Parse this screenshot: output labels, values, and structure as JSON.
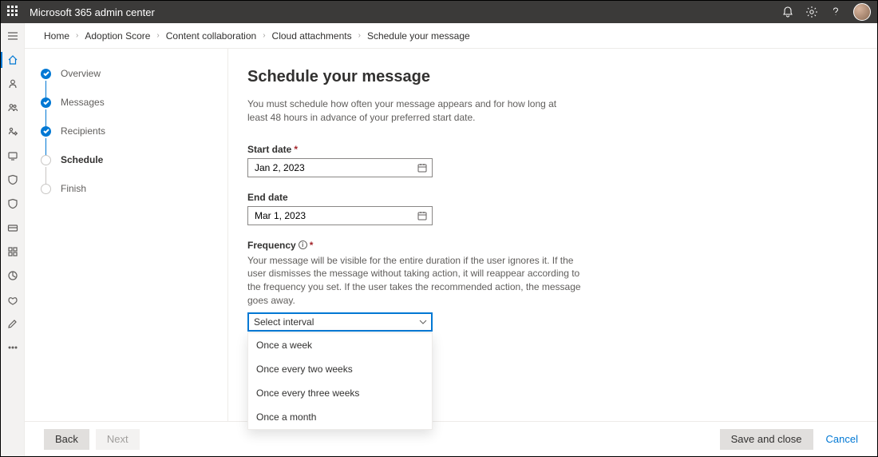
{
  "topbar": {
    "title": "Microsoft 365 admin center"
  },
  "breadcrumb": {
    "items": [
      "Home",
      "Adoption Score",
      "Content collaboration",
      "Cloud attachments",
      "Schedule your message"
    ]
  },
  "leftrail": {
    "items": [
      {
        "name": "menu-icon"
      },
      {
        "name": "home-icon",
        "active": true
      },
      {
        "name": "users-icon"
      },
      {
        "name": "teams-icon"
      },
      {
        "name": "roles-icon"
      },
      {
        "name": "resources-icon"
      },
      {
        "name": "billing-icon"
      },
      {
        "name": "support-icon"
      },
      {
        "name": "settings-icon"
      },
      {
        "name": "setup-icon"
      },
      {
        "name": "reports-icon"
      },
      {
        "name": "health-icon"
      },
      {
        "name": "edit-icon"
      },
      {
        "name": "more-icon"
      }
    ]
  },
  "stepper": {
    "steps": [
      {
        "label": "Overview",
        "state": "done"
      },
      {
        "label": "Messages",
        "state": "done"
      },
      {
        "label": "Recipients",
        "state": "done"
      },
      {
        "label": "Schedule",
        "state": "current"
      },
      {
        "label": "Finish",
        "state": "pending"
      }
    ]
  },
  "content": {
    "title": "Schedule your message",
    "intro": "You must schedule how often your message appears and for how long at least 48 hours in advance of your preferred start date.",
    "start_date_label": "Start date",
    "start_date_value": "Jan 2, 2023",
    "end_date_label": "End date",
    "end_date_value": "Mar 1, 2023",
    "frequency_label": "Frequency",
    "frequency_helper": "Your message will be visible for the entire duration if the user ignores it. If the user dismisses the message without taking action, it will reappear according to the frequency you set. If the user takes the recommended action, the message goes away.",
    "frequency_placeholder": "Select interval",
    "frequency_options": [
      "Once a week",
      "Once every two weeks",
      "Once every three weeks",
      "Once a month"
    ]
  },
  "footer": {
    "back": "Back",
    "next": "Next",
    "save": "Save and close",
    "cancel": "Cancel"
  }
}
